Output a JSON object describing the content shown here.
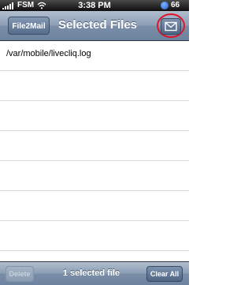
{
  "status_bar": {
    "carrier": "FSM",
    "time": "3:38 PM",
    "battery": "66"
  },
  "nav_bar": {
    "back_label": "File2Mail",
    "title": "Selected Files",
    "mail_icon": "envelope-icon",
    "highlight_color": "#e0142a"
  },
  "file_list": {
    "rows": [
      "/var/mobile/livecliq.log",
      "",
      "",
      "",
      "",
      "",
      "",
      ""
    ]
  },
  "toolbar": {
    "delete_label": "Delete",
    "status": "1 selected file",
    "clear_label": "Clear All"
  }
}
